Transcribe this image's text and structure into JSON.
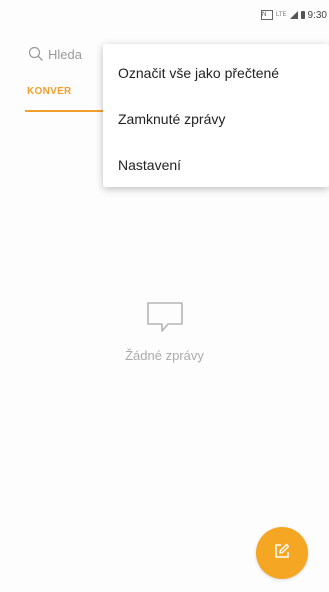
{
  "status_bar": {
    "nfc_label": "N",
    "lte_label": "LTE",
    "time": "9:30"
  },
  "search": {
    "placeholder": "Hleda"
  },
  "tabs": {
    "conversations_label": "KONVER"
  },
  "menu": {
    "items": [
      {
        "label": "Označit vše jako přečtené"
      },
      {
        "label": "Zamknuté zprávy"
      },
      {
        "label": "Nastavení"
      }
    ]
  },
  "empty_state": {
    "text": "Žádné zprávy"
  },
  "colors": {
    "accent": "#f0a030",
    "fab": "#f5a623"
  },
  "fab": {
    "icon": "compose-icon"
  }
}
